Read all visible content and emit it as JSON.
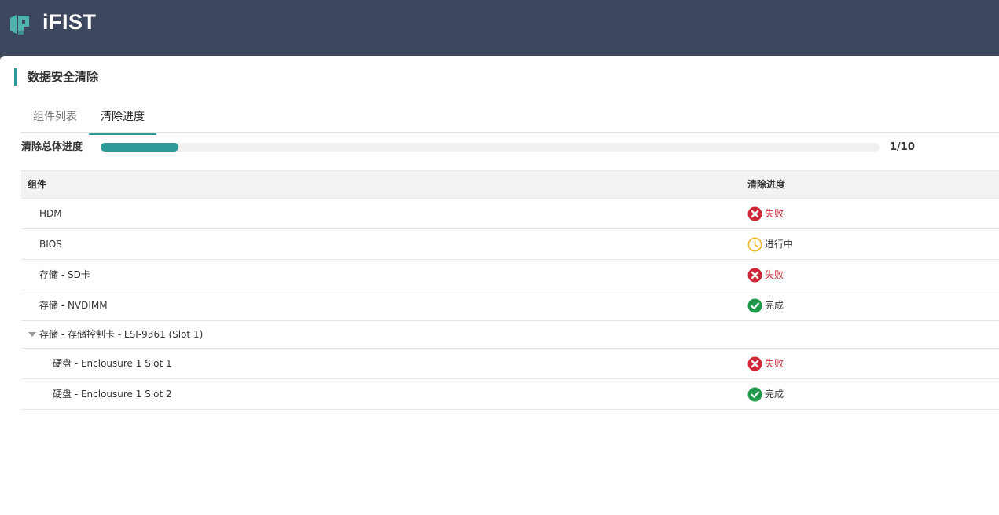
{
  "app": {
    "brand": "iFIST"
  },
  "page": {
    "title": "数据安全清除"
  },
  "tabs": [
    {
      "label": "组件列表",
      "active": false
    },
    {
      "label": "清除进度",
      "active": true
    }
  ],
  "progress": {
    "label": "清除总体进度",
    "done": 1,
    "total": 10,
    "text": "1/10",
    "fraction": 0.1
  },
  "table": {
    "columns": {
      "component": "组件",
      "status": "清除进度"
    },
    "rows": [
      {
        "name": "HDM",
        "status": "失败",
        "state": "fail",
        "icon": "x-circle-icon"
      },
      {
        "name": "BIOS",
        "status": "进行中",
        "state": "running",
        "icon": "clock-icon"
      },
      {
        "name": "存储 - SD卡",
        "status": "失败",
        "state": "fail",
        "icon": "x-circle-icon"
      },
      {
        "name": "存储 - NVDIMM",
        "status": "完成",
        "state": "done",
        "icon": "check-circle-icon"
      }
    ],
    "group": {
      "name": "存储 - 存储控制卡 - LSI-9361 (Slot 1)",
      "expanded": true,
      "children": [
        {
          "name": "硬盘 - Enclousure 1 Slot 1",
          "status": "失败",
          "state": "fail",
          "icon": "x-circle-icon"
        },
        {
          "name": "硬盘 - Enclousure 1 Slot 2",
          "status": "完成",
          "state": "done",
          "icon": "check-circle-icon"
        }
      ]
    }
  },
  "colors": {
    "header_bg": "#3d475e",
    "accent": "#2e9a98",
    "fail": "#d0273a",
    "running": "#f0b62a",
    "done": "#1f9a4a"
  }
}
